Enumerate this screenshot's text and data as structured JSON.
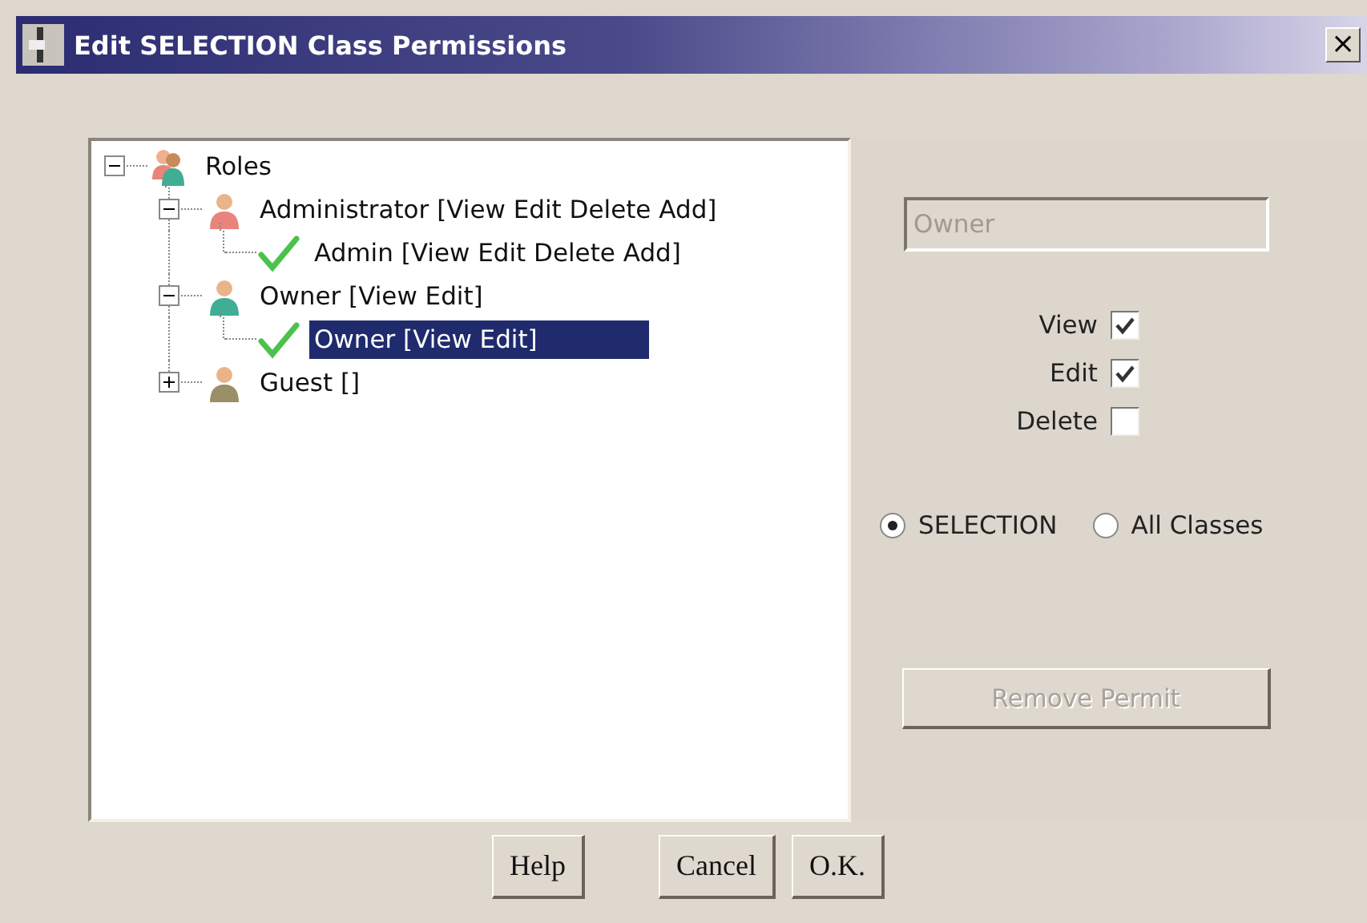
{
  "window": {
    "title": "Edit SELECTION Class Permissions",
    "close": "×"
  },
  "tree": [
    {
      "kind": "group",
      "label": "Roles",
      "expanded": true,
      "selected": false,
      "children": [
        {
          "kind": "role",
          "label": "Administrator [View Edit Delete Add]",
          "color": "#e8847c",
          "expanded": true,
          "selected": false,
          "children": [
            {
              "kind": "permit",
              "label": "Admin [View Edit Delete Add]",
              "selected": false
            }
          ]
        },
        {
          "kind": "role",
          "label": "Owner [View Edit]",
          "color": "#3fae94",
          "expanded": true,
          "selected": false,
          "children": [
            {
              "kind": "permit",
              "label": "Owner [View Edit]",
              "selected": true
            }
          ]
        },
        {
          "kind": "role",
          "label": "Guest []",
          "color": "#9a8f66",
          "expanded": false,
          "selected": false
        }
      ]
    }
  ],
  "name_field": {
    "value": "Owner",
    "disabled": true
  },
  "permissions": [
    {
      "label": "View",
      "checked": true
    },
    {
      "label": "Edit",
      "checked": true
    },
    {
      "label": "Delete",
      "checked": false
    }
  ],
  "scope": [
    {
      "label": "SELECTION",
      "selected": true
    },
    {
      "label": "All Classes",
      "selected": false
    }
  ],
  "remove_button": {
    "label": "Remove Permit",
    "disabled": true
  },
  "buttons": [
    "Help",
    "Cancel",
    "O.K."
  ]
}
